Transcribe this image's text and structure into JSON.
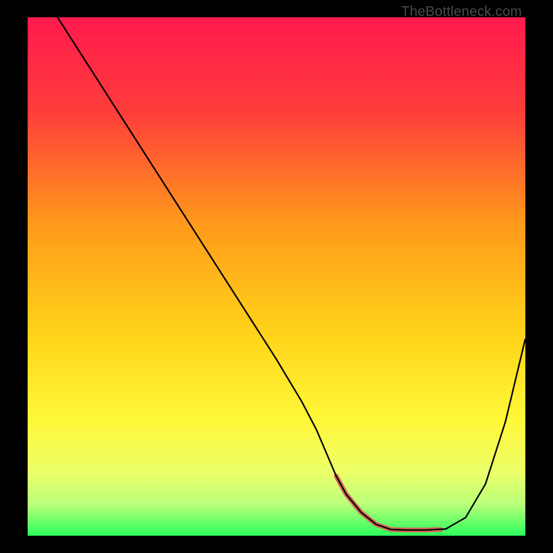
{
  "watermark": "TheBottleneck.com",
  "chart_data": {
    "type": "line",
    "title": "",
    "xlabel": "",
    "ylabel": "",
    "xlim": [
      0,
      100
    ],
    "ylim": [
      0,
      100
    ],
    "gradient_stops": [
      {
        "offset": 0,
        "color": "#ff1a4d"
      },
      {
        "offset": 18,
        "color": "#ff3c3c"
      },
      {
        "offset": 40,
        "color": "#ff9a1a"
      },
      {
        "offset": 62,
        "color": "#ffd61a"
      },
      {
        "offset": 78,
        "color": "#fff83a"
      },
      {
        "offset": 88,
        "color": "#eaff6a"
      },
      {
        "offset": 94,
        "color": "#b8ff7a"
      },
      {
        "offset": 100,
        "color": "#2bff5c"
      }
    ],
    "series": [
      {
        "name": "curve",
        "stroke": "#000000",
        "width": 2.2,
        "x": [
          6,
          10,
          15,
          20,
          25,
          30,
          35,
          40,
          45,
          50,
          55,
          58,
          60,
          62,
          64,
          67,
          70,
          73,
          76,
          80,
          84,
          88,
          92,
          96,
          100
        ],
        "y": [
          100,
          94,
          86.5,
          79,
          71.5,
          64,
          56.5,
          49,
          41.5,
          34,
          26,
          20.5,
          16,
          11.5,
          8,
          4.5,
          2.2,
          1.2,
          1.1,
          1.1,
          1.3,
          3.5,
          10,
          22,
          38
        ]
      },
      {
        "name": "valley-highlight",
        "stroke": "#d86a5a",
        "width": 7,
        "linecap": "round",
        "x": [
          62,
          64,
          67,
          70,
          73,
          76,
          80,
          83
        ],
        "y": [
          11.5,
          8,
          4.5,
          2.2,
          1.2,
          1.1,
          1.1,
          1.2
        ]
      }
    ]
  }
}
